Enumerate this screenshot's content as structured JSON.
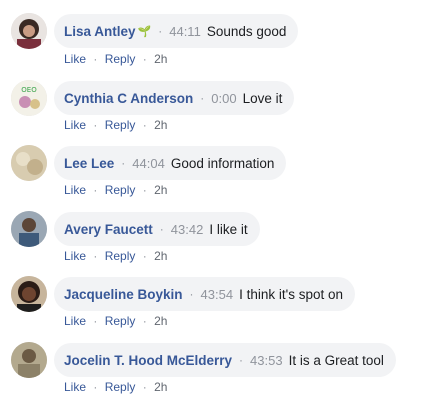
{
  "comments": [
    {
      "author": "Lisa Antley",
      "author_icon": "seedling-icon",
      "author_icon_glyph": "🌱",
      "timestamp": "44:11",
      "text": "Sounds good",
      "like_label": "Like",
      "reply_label": "Reply",
      "age": "2h",
      "avatar_color": "#3a2a24"
    },
    {
      "author": "Cynthia C Anderson",
      "timestamp": "0:00",
      "text": "Love it",
      "like_label": "Like",
      "reply_label": "Reply",
      "age": "2h",
      "avatar_color": "#f3f1e8"
    },
    {
      "author": "Lee Lee",
      "timestamp": "44:04",
      "text": "Good information",
      "like_label": "Like",
      "reply_label": "Reply",
      "age": "2h",
      "avatar_color": "#d8ccb0"
    },
    {
      "author": "Avery Faucett",
      "timestamp": "43:42",
      "text": "I like it",
      "like_label": "Like",
      "reply_label": "Reply",
      "age": "2h",
      "avatar_color": "#7e8a98"
    },
    {
      "author": "Jacqueline Boykin",
      "timestamp": "43:54",
      "text": "I think it's spot on",
      "like_label": "Like",
      "reply_label": "Reply",
      "age": "2h",
      "avatar_color": "#5a3a2c"
    },
    {
      "author": "Jocelin T. Hood McElderry",
      "timestamp": "43:53",
      "text": "It is a Great tool",
      "like_label": "Like",
      "reply_label": "Reply",
      "age": "2h",
      "avatar_color": "#8c8168"
    }
  ],
  "separator": "·",
  "colors": {
    "author_link": "#385898",
    "bubble_bg": "#f2f3f5",
    "meta_gray": "#90949c",
    "text": "#1c1e21"
  }
}
